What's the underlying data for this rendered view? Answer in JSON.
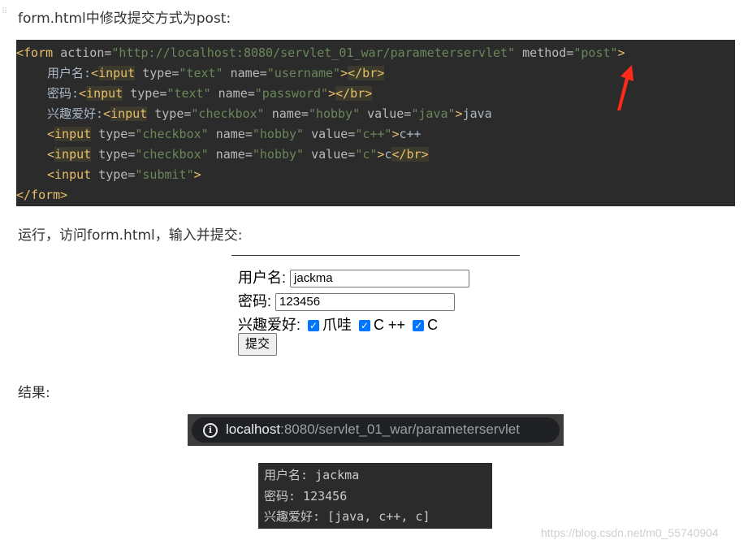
{
  "intro": "form.html中修改提交方式为post:",
  "code_block": {
    "form_open_tag": "<form",
    "action_attr": " action=",
    "action_value": "\"http://localhost:8080/servlet_01_war/parameterservlet\"",
    "method_attr": " method=",
    "method_value": "\"post\"",
    "gt": ">",
    "line2_label": "用户名:",
    "line3_label": "密码:",
    "line4_label": "兴趣爱好:",
    "input_tag": "<input",
    "type_attr": " type=",
    "name_attr": " name=",
    "value_attr": " value=",
    "text_type": "\"text\"",
    "username_name": "\"username\"",
    "password_name": "\"password\"",
    "checkbox_type": "\"checkbox\"",
    "hobby_name": "\"hobby\"",
    "java_value": "\"java\"",
    "cpp_value": "\"c++\"",
    "c_value": "\"c\"",
    "java_text": "java",
    "cpp_text": "c++",
    "c_text": "c",
    "br_tag": "</br>",
    "submit_type": "\"submit\"",
    "form_close_tag": "</form>",
    "lt": "<"
  },
  "run_text": "运行，访问form.html，输入并提交:",
  "form_demo": {
    "username_label": "用户名:",
    "username_value": "jackma",
    "password_label": "密码:",
    "password_value": "123456",
    "hobby_label": "兴趣爱好:",
    "hobby_java": "爪哇",
    "hobby_cpp": "C ++",
    "hobby_c": "C",
    "submit_label": "提交",
    "checkmark": "✓"
  },
  "result_heading": "结果:",
  "browser": {
    "url_host": "localhost",
    "url_rest": ":8080/servlet_01_war/parameterservlet",
    "info_glyph": "i"
  },
  "result_output": {
    "line1": "用户名: jackma",
    "line2": "密码: 123456",
    "line3": "兴趣爱好: [java, c++, c]"
  },
  "watermark": "https://blog.csdn.net/m0_55740904",
  "colors": {
    "code_bg": "#2b2b2b",
    "tag": "#e8bf6a",
    "string": "#6a8759",
    "arrow": "#ff2a1a",
    "checkbox": "#0075ff"
  }
}
